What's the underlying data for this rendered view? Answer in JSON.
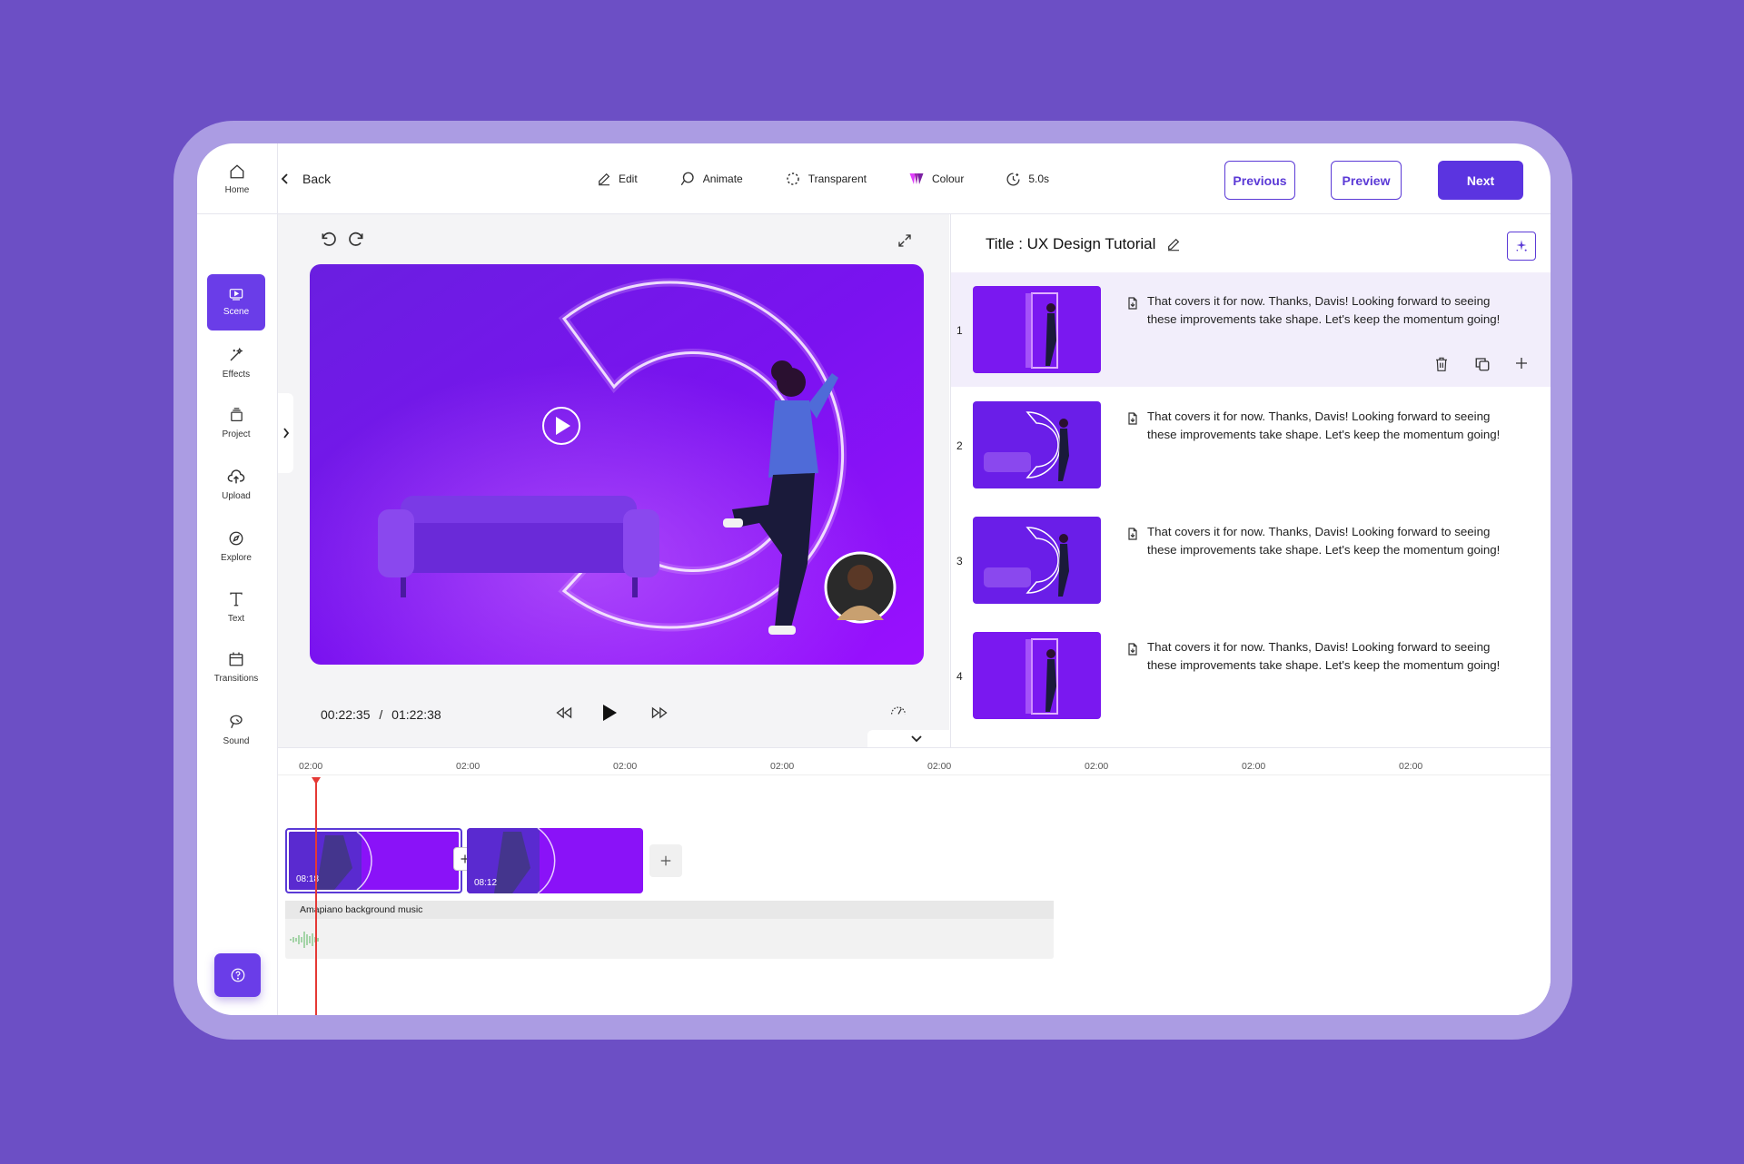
{
  "topbar": {
    "home_label": "Home",
    "back_label": "Back",
    "tools": [
      {
        "label": "Edit",
        "icon": "pencil-icon"
      },
      {
        "label": "Animate",
        "icon": "animate-icon"
      },
      {
        "label": "Transparent",
        "icon": "transparent-icon"
      },
      {
        "label": "Colour",
        "icon": "colour-icon"
      },
      {
        "label": "5.0s",
        "icon": "duration-icon"
      }
    ],
    "previous_label": "Previous",
    "preview_label": "Preview",
    "next_label": "Next"
  },
  "sidebar": {
    "items": [
      {
        "label": "Scene",
        "icon": "scene-icon"
      },
      {
        "label": "Effects",
        "icon": "effects-icon"
      },
      {
        "label": "Project",
        "icon": "project-icon"
      },
      {
        "label": "Upload",
        "icon": "upload-icon"
      },
      {
        "label": "Explore",
        "icon": "explore-icon"
      },
      {
        "label": "Text",
        "icon": "text-icon"
      },
      {
        "label": "Transitions",
        "icon": "transitions-icon"
      },
      {
        "label": "Sound",
        "icon": "sound-icon"
      }
    ],
    "help_icon": "help-icon"
  },
  "player": {
    "current_time": "00:22:35",
    "separator": "/",
    "total_time": "01:22:38"
  },
  "panel": {
    "title": "Title : UX Design Tutorial",
    "scenes": [
      {
        "number": "1",
        "text": "That covers it for now. Thanks, Davis! Looking forward to seeing these improvements take shape. Let's keep the momentum going!",
        "selected": true
      },
      {
        "number": "2",
        "text": "That covers it for now. Thanks, Davis! Looking forward to seeing these improvements take shape. Let's keep the momentum going!",
        "selected": false
      },
      {
        "number": "3",
        "text": "That covers it for now. Thanks, Davis! Looking forward to seeing these improvements take shape. Let's keep the momentum going!",
        "selected": false
      },
      {
        "number": "4",
        "text": "That covers it for now. Thanks, Davis! Looking forward to seeing these improvements take shape. Let's keep the momentum going!",
        "selected": false
      }
    ]
  },
  "timeline": {
    "ticks": [
      "02:00",
      "02:00",
      "02:00",
      "02:00",
      "02:00",
      "02:00",
      "02:00",
      "02:00"
    ],
    "clips": [
      {
        "time": "08:18"
      },
      {
        "time": "08:12"
      }
    ],
    "audio_label": "Amapiano background music"
  },
  "colors": {
    "background": "#6c4fc5",
    "accent": "#5b34e0",
    "playhead": "#e53935"
  }
}
